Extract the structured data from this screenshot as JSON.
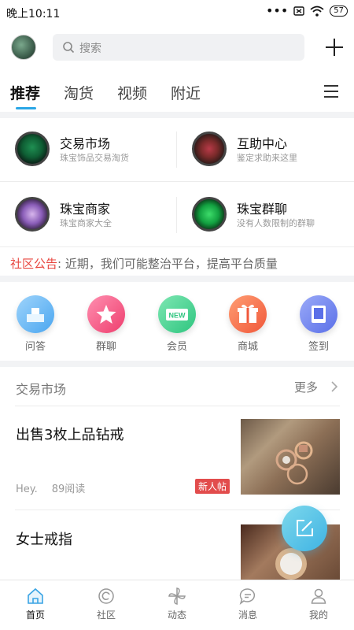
{
  "status_bar": {
    "time": "晚上10:11",
    "battery": "57"
  },
  "search": {
    "placeholder": "搜索"
  },
  "tabs": [
    {
      "label": "推荐",
      "active": true
    },
    {
      "label": "淘货",
      "active": false
    },
    {
      "label": "视频",
      "active": false
    },
    {
      "label": "附近",
      "active": false
    }
  ],
  "categories": [
    {
      "title": "交易市场",
      "subtitle": "珠宝饰品交易淘货"
    },
    {
      "title": "互助中心",
      "subtitle": "鉴定求助来这里"
    },
    {
      "title": "珠宝商家",
      "subtitle": "珠宝商家大全"
    },
    {
      "title": "珠宝群聊",
      "subtitle": "没有人数限制的群聊"
    }
  ],
  "notice": {
    "label": "社区公告",
    "text": ": 近期，我们可能整治平台，提高平台质量"
  },
  "shortcuts": [
    {
      "label": "问答",
      "icon": "podium-icon",
      "color": "#5fb3f2"
    },
    {
      "label": "群聊",
      "icon": "star-icon",
      "color": "#f2567e"
    },
    {
      "label": "会员",
      "icon": "new-icon",
      "color": "#3fcf8c"
    },
    {
      "label": "商城",
      "icon": "gift-icon",
      "color": "#f4704a"
    },
    {
      "label": "签到",
      "icon": "tablet-icon",
      "color": "#6b83f0"
    }
  ],
  "section": {
    "title": "交易市场",
    "more": "更多"
  },
  "posts": [
    {
      "title": "出售3枚上品钻戒",
      "author": "Hey.",
      "reads": "89阅读",
      "badge": "新人帖"
    },
    {
      "title": "女士戒指"
    }
  ],
  "bottom_nav": [
    {
      "label": "首页",
      "icon": "home-icon",
      "active": true
    },
    {
      "label": "社区",
      "icon": "community-icon",
      "active": false
    },
    {
      "label": "动态",
      "icon": "pinwheel-icon",
      "active": false
    },
    {
      "label": "消息",
      "icon": "message-icon",
      "active": false
    },
    {
      "label": "我的",
      "icon": "profile-icon",
      "active": false
    }
  ],
  "colors": {
    "accent": "#2aa6e6",
    "notice_red": "#e8463f",
    "badge_red": "#e24c4c"
  }
}
